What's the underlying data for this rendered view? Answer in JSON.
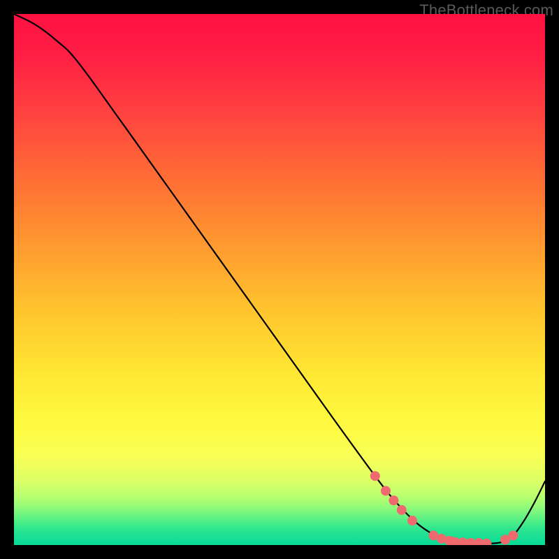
{
  "watermark": "TheBottleneck.com",
  "chart_data": {
    "type": "line",
    "title": "",
    "xlabel": "",
    "ylabel": "",
    "xlim": [
      0,
      100
    ],
    "ylim": [
      0,
      100
    ],
    "series": [
      {
        "name": "curve",
        "x": [
          0,
          4,
          8,
          12,
          20,
          30,
          40,
          50,
          60,
          68,
          72,
          76,
          80,
          84,
          88,
          90,
          92,
          94,
          96,
          98,
          100
        ],
        "y": [
          100,
          98,
          95,
          91,
          80,
          66,
          52,
          38,
          24,
          13,
          8,
          4,
          1.5,
          0.5,
          0.3,
          0.3,
          0.6,
          1.8,
          4.5,
          8,
          12
        ]
      }
    ],
    "markers": {
      "name": "highlight-dots",
      "color": "#ef6a6e",
      "points": [
        {
          "x": 68.0,
          "y": 13.0
        },
        {
          "x": 70.0,
          "y": 10.2
        },
        {
          "x": 71.5,
          "y": 8.4
        },
        {
          "x": 73.0,
          "y": 6.6
        },
        {
          "x": 75.0,
          "y": 4.6
        },
        {
          "x": 79.0,
          "y": 1.8
        },
        {
          "x": 80.5,
          "y": 1.2
        },
        {
          "x": 82.0,
          "y": 0.8
        },
        {
          "x": 83.0,
          "y": 0.6
        },
        {
          "x": 84.5,
          "y": 0.5
        },
        {
          "x": 86.0,
          "y": 0.4
        },
        {
          "x": 87.5,
          "y": 0.4
        },
        {
          "x": 89.0,
          "y": 0.3
        },
        {
          "x": 92.5,
          "y": 1.0
        },
        {
          "x": 94.0,
          "y": 1.8
        }
      ]
    },
    "gradient_stops": [
      {
        "offset": 0.0,
        "color": "#ff1141"
      },
      {
        "offset": 0.08,
        "color": "#ff1f44"
      },
      {
        "offset": 0.18,
        "color": "#ff4040"
      },
      {
        "offset": 0.3,
        "color": "#ff6a35"
      },
      {
        "offset": 0.42,
        "color": "#ff9430"
      },
      {
        "offset": 0.55,
        "color": "#ffc22e"
      },
      {
        "offset": 0.68,
        "color": "#ffe833"
      },
      {
        "offset": 0.78,
        "color": "#fffb42"
      },
      {
        "offset": 0.84,
        "color": "#f6ff58"
      },
      {
        "offset": 0.88,
        "color": "#dbff66"
      },
      {
        "offset": 0.91,
        "color": "#b6ff70"
      },
      {
        "offset": 0.93,
        "color": "#8efb7a"
      },
      {
        "offset": 0.95,
        "color": "#5cf184"
      },
      {
        "offset": 0.97,
        "color": "#2de68f"
      },
      {
        "offset": 1.0,
        "color": "#07da98"
      }
    ]
  }
}
